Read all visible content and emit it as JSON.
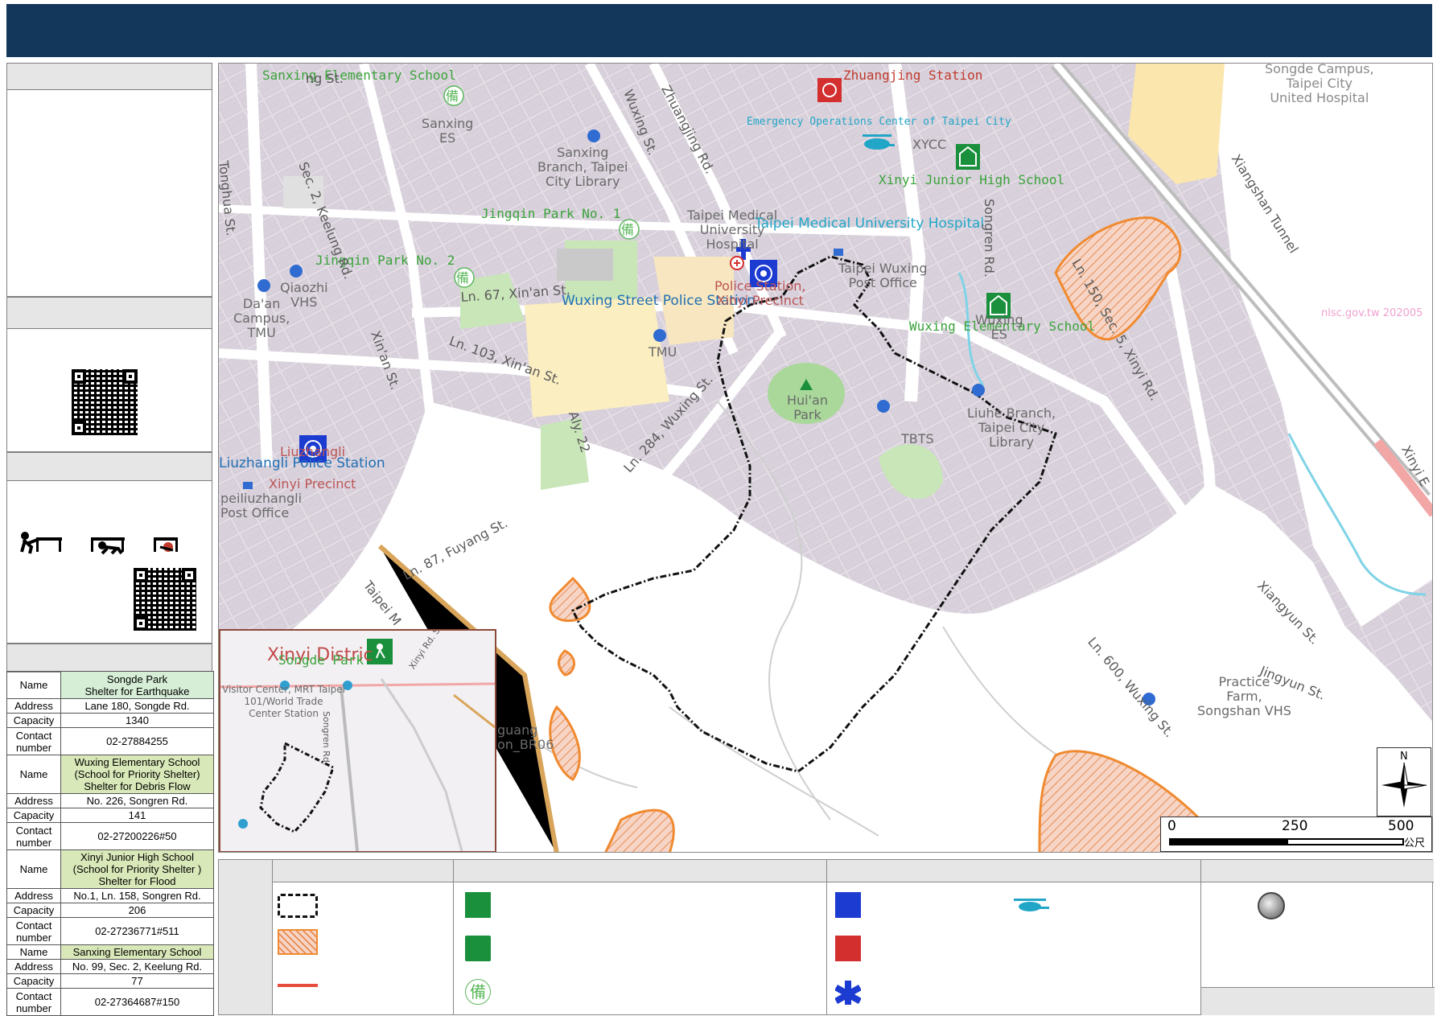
{
  "map": {
    "labels": {
      "sanxing_es_school": "Sanxing Elementary School",
      "sanxing_es": "Sanxing\nES",
      "sanxing_library": "Sanxing\nBranch, Taipei\nCity Library",
      "zhuangjing_station": "Zhuangjing Station",
      "eoc": "Emergency Operations Center of Taipei City",
      "xycc": "XYCC",
      "xinyi_jhs": "Xinyi Junior High School",
      "songde_campus": "Songde Campus,\nTaipei City\nUnited Hospital",
      "jingqin_park_1": "Jingqin Park No. 1",
      "jingqin_park_2": "Jingqin Park No. 2",
      "tmu_hospital_small": "Taipei Medical\nUniversity\nHospital",
      "tmu_hospital": "Taipei Medical University Hospital",
      "wuxing_post": "Taipei Wuxing\nPost Office",
      "qiaozhi_vhs": "Qiaozhi\nVHS",
      "daan_campus": "Da'an\nCampus,\nTMU",
      "wuxing_police": "Wuxing Street Police Station",
      "police_station_precinct": "Police Station,\nXinyi Precinct",
      "wuxing_es_school": "Wuxing Elementary School",
      "wuxing_es": "Wuxing\nES",
      "tmu": "TMU",
      "huian_park": "Hui'an\nPark",
      "tbts": "TBTS",
      "liuhe_library": "Liuhe Branch,\nTaipei City\nLibrary",
      "liuzhangli_small": "Liuzhangli",
      "liuzhangli_police": "Liuzhangli Police Station",
      "xinyi_precinct": "Xinyi Precinct",
      "liuzhangli_post": "peiliuzhangli\nPost Office",
      "practice_farm": "Practice\nFarm,\nSongshan VHS",
      "source": "nlsc.gov.tw 202005",
      "guang": "guang\non_BR06",
      "mt": "Mt"
    },
    "roads": {
      "tonghua": "Tonghua St.",
      "keelung": "Sec. 2, Keelung Rd.",
      "wuxing_st": "Wuxing St.",
      "zhuangjing_rd": "Zhuangjing Rd.",
      "xiangshan": "Xiangshan Tunnel",
      "songren": "Songren Rd.",
      "ln150": "Ln. 150, Sec. 5, Xinyi Rd.",
      "ln67": "Ln. 67, Xin'an St.",
      "xinan": "Xin'an St.",
      "ln103": "Ln. 103, Xin'an St.",
      "ln284": "Ln. 284, Wuxing St.",
      "aly22": "Aly. 22",
      "ln87": "Ln. 87, Fuyang St.",
      "taipei_m": "Taipei M",
      "ln600": "Ln. 600, Wuxing St.",
      "xiangyun": "Xiangyun St.",
      "jingyun": "Jingyun St.",
      "xinyi_e": "Xinyi E",
      "st_top": "ng St."
    },
    "inset": {
      "district": "Xinyi Distric",
      "songde_park": "Songde Park",
      "visitor_center": "Visitor Center, MRT Taipei\n101/World Trade\nCenter Station",
      "xinyi_rd": "Xinyi Rd. S",
      "songren": "Songren Rd."
    },
    "compass_letter": "N",
    "scale": {
      "zero": "0",
      "mid": "250",
      "max": "500",
      "unit": "公尺"
    }
  },
  "shelters": [
    {
      "name_label": "Name",
      "name": "Songde Park\nShelter for Earthquake",
      "address_label": "Address",
      "address": "Lane 180, Songde Rd.",
      "capacity_label": "Capacity",
      "capacity": "1340",
      "contact_label": "Contact\nnumber",
      "contact": "02-27884255"
    },
    {
      "name_label": "Name",
      "name": "Wuxing Elementary School\n(School for Priority Shelter)\nShelter for Debris Flow",
      "address_label": "Address",
      "address": "No. 226, Songren Rd.",
      "capacity_label": "Capacity",
      "capacity": "141",
      "contact_label": "Contact\nnumber",
      "contact": "02-27200226#50"
    },
    {
      "name_label": "Name",
      "name": "Xinyi Junior High School\n(School for Priority Shelter )\nShelter for Flood",
      "address_label": "Address",
      "address": "No.1, Ln. 158, Songren Rd.",
      "capacity_label": "Capacity",
      "capacity": "206",
      "contact_label": "Contact\nnumber",
      "contact": "02-27236771#511"
    },
    {
      "name_label": "Name",
      "name": "Sanxing Elementary School",
      "address_label": "Address",
      "address": "No. 99, Sec. 2, Keelung Rd.",
      "capacity_label": "Capacity",
      "capacity": "77",
      "contact_label": "Contact\nnumber",
      "contact": "02-27364687#150"
    }
  ],
  "legend": {
    "icons": [
      "boundary-line-icon",
      "hazard-area-icon",
      "red-line-icon",
      "school-shelter-icon",
      "park-shelter-icon",
      "reserve-shelter-icon",
      "police-icon",
      "fire-station-icon",
      "hospital-icon",
      "helicopter-icon",
      "gray-dot-icon"
    ]
  },
  "colors": {
    "title_bar": "#13365b",
    "shelter_green": "#1a8f3c",
    "police_blue": "#1c3bd1",
    "hazard_orange": "#f08a30",
    "cyan_labels": "#22a6c7"
  }
}
